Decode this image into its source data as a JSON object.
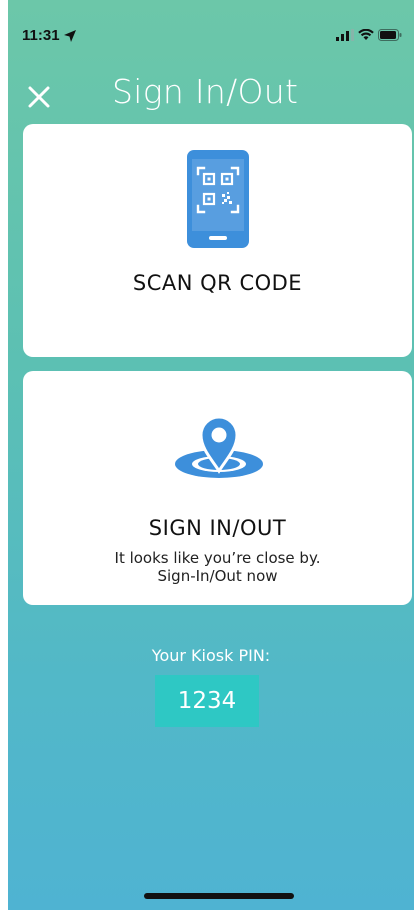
{
  "status_bar": {
    "time": "11:31"
  },
  "header": {
    "title": "Sign In/Out"
  },
  "cards": {
    "scan_qr": {
      "title": "SCAN QR CODE"
    },
    "sign_in_out": {
      "title": "SIGN IN/OUT",
      "subtitle_line1": "It looks like you’re close by.",
      "subtitle_line2": "Sign-In/Out now"
    }
  },
  "kiosk": {
    "label": "Your Kiosk PIN:",
    "pin": "1234"
  },
  "colors": {
    "background_top": "#6cc7a9",
    "background_bottom": "#4fb3d2",
    "icon_blue": "#3d8fdb",
    "pin_box": "#2ec8c4"
  },
  "icons": [
    "location-arrow-icon",
    "signal-icon",
    "wifi-icon",
    "battery-icon",
    "close-icon",
    "qr-phone-icon",
    "map-pin-icon"
  ]
}
